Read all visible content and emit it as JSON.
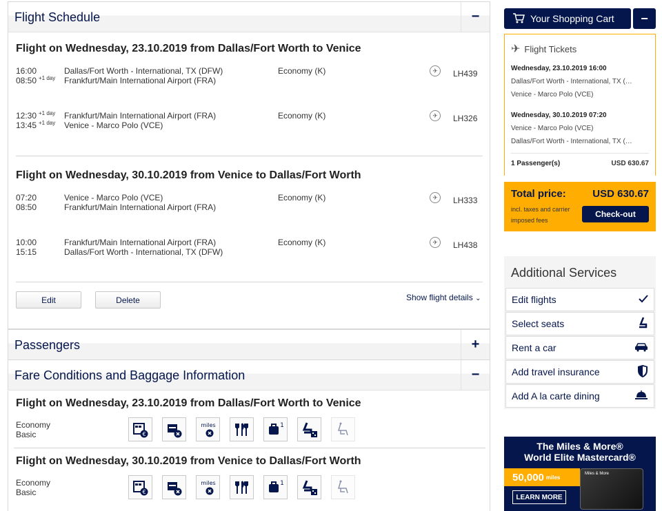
{
  "flight_schedule": {
    "title": "Flight Schedule",
    "toggle": "−",
    "outbound": {
      "title": "Flight on Wednesday, 23.10.2019 from Dallas/Fort Worth to Venice",
      "legs": [
        {
          "dep_time": "16:00",
          "dep_sup": "",
          "dep_airport": "Dallas/Fort Worth - International, TX (DFW)",
          "arr_time": "08:50",
          "arr_sup": "+1 day",
          "arr_airport": "Frankfurt/Main International Airport (FRA)",
          "cabin": "Economy (K)",
          "flight_no": "LH439"
        },
        {
          "dep_time": "12:30",
          "dep_sup": "+1 day",
          "dep_airport": "Frankfurt/Main International Airport (FRA)",
          "arr_time": "13:45",
          "arr_sup": "+1 day",
          "arr_airport": "Venice - Marco Polo (VCE)",
          "cabin": "Economy (K)",
          "flight_no": "LH326"
        }
      ]
    },
    "inbound": {
      "title": "Flight on Wednesday, 30.10.2019 from Venice to Dallas/Fort Worth",
      "legs": [
        {
          "dep_time": "07:20",
          "dep_sup": "",
          "dep_airport": "Venice - Marco Polo (VCE)",
          "arr_time": "08:50",
          "arr_sup": "",
          "arr_airport": "Frankfurt/Main International Airport (FRA)",
          "cabin": "Economy (K)",
          "flight_no": "LH333"
        },
        {
          "dep_time": "10:00",
          "dep_sup": "",
          "dep_airport": "Frankfurt/Main International Airport (FRA)",
          "arr_time": "15:15",
          "arr_sup": "",
          "arr_airport": "Dallas/Fort Worth - International, TX (DFW)",
          "cabin": "Economy (K)",
          "flight_no": "LH438"
        }
      ]
    },
    "edit_label": "Edit",
    "delete_label": "Delete",
    "show_details": "Show flight details"
  },
  "passengers": {
    "title": "Passengers",
    "toggle": "+"
  },
  "fare": {
    "title": "Fare Conditions and Baggage Information",
    "toggle": "−",
    "blocks": [
      {
        "title": "Flight on Wednesday, 23.10.2019 from Dallas/Fort Worth to Venice",
        "fare_line1": "Economy",
        "fare_line2": "Basic"
      },
      {
        "title": "Flight on Wednesday, 30.10.2019 from Venice to Dallas/Fort Worth",
        "fare_line1": "Economy",
        "fare_line2": "Basic"
      }
    ],
    "icons": [
      "rebooking-fee-icon",
      "refund-not-allowed-icon",
      "miles-not-earned-icon",
      "meal-icon",
      "carry-on-baggage-icon",
      "seat-reservation-fee-icon",
      "upgrade-unavailable-icon"
    ],
    "miles_text": "miles",
    "bag_count": "1"
  },
  "cart": {
    "button_label": "Your Shopping Cart",
    "collapse": "−",
    "tickets_header": "Flight Tickets",
    "trips": [
      {
        "datetime": "Wednesday, 23.10.2019 16:00",
        "from": "Dallas/Fort Worth - International, TX (…",
        "to": "Venice - Marco Polo (VCE)"
      },
      {
        "datetime": "Wednesday, 30.10.2019 07:20",
        "from": "Venice - Marco Polo (VCE)",
        "to": "Dallas/Fort Worth - International, TX (…"
      }
    ],
    "passengers_label": "1 Passenger(s)",
    "passengers_amount": "USD 630.67",
    "total_label": "Total price:",
    "total_amount": "USD 630.67",
    "total_note": "incl. taxes and carrier imposed fees",
    "checkout": "Check-out",
    "accent": "#ffad00",
    "brand": "#05164d"
  },
  "additional_services": {
    "title": "Additional Services",
    "items": [
      {
        "label": "Edit flights",
        "icon": "checkmark-icon"
      },
      {
        "label": "Select seats",
        "icon": "seat-icon"
      },
      {
        "label": "Rent a car",
        "icon": "car-icon"
      },
      {
        "label": "Add travel insurance",
        "icon": "shield-icon"
      },
      {
        "label": "Add A la carte dining",
        "icon": "dining-cloche-icon"
      }
    ]
  },
  "ad": {
    "line1": "The Miles & More®",
    "line2": "World Elite Mastercard®",
    "miles": "50,000",
    "miles_unit": "miles",
    "learn_more": "LEARN MORE",
    "card_brand": "Miles & More"
  }
}
